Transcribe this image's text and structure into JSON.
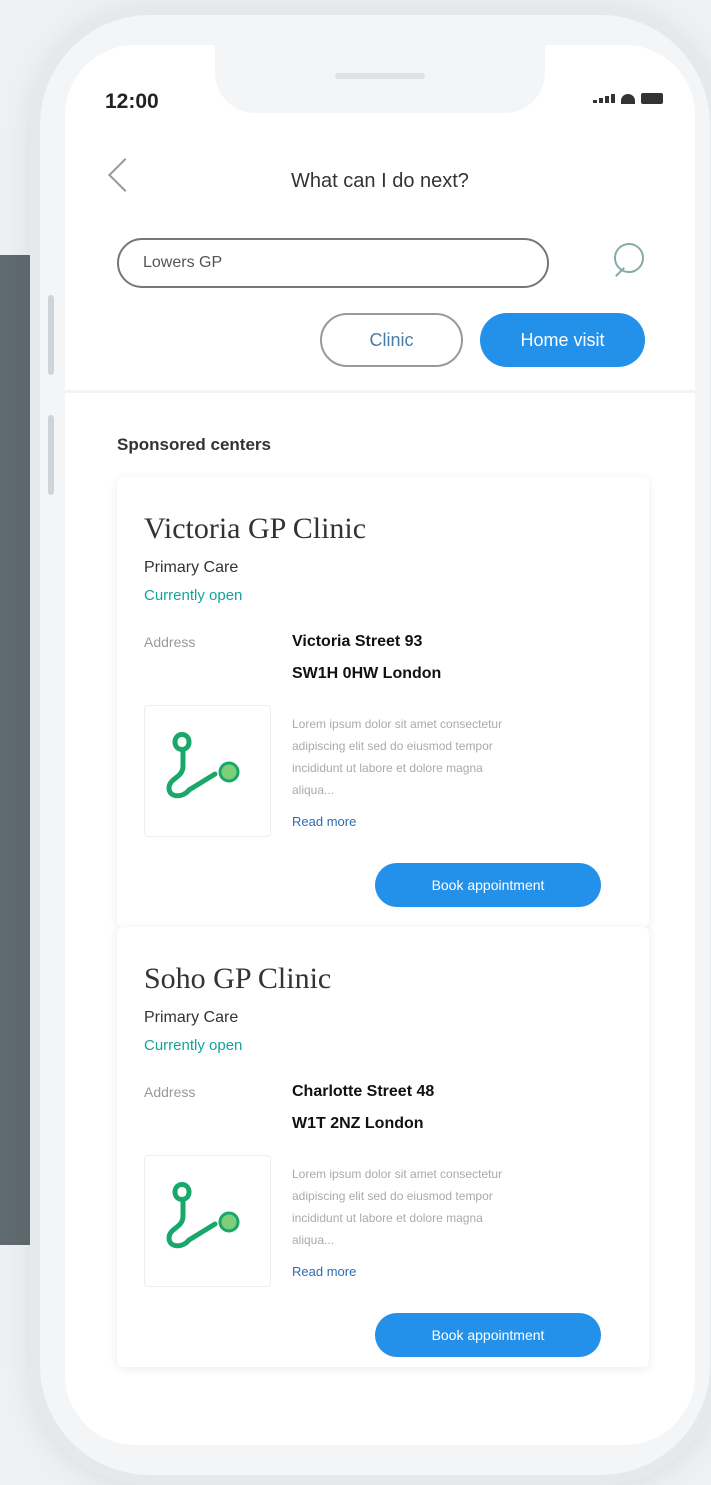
{
  "status_bar": {
    "time": "12:00"
  },
  "header": {
    "title": "What can I do next?"
  },
  "search": {
    "value": "Lowers GP"
  },
  "filters": {
    "clinic_label": "Clinic",
    "home_visit_label": "Home visit"
  },
  "section": {
    "label": "Sponsored centers"
  },
  "clinics": [
    {
      "name": "Victoria GP Clinic",
      "category": "Primary Care",
      "status": "Currently open",
      "address_label": "Address",
      "address_line1": "Victoria Street 93",
      "address_line2": "SW1H 0HW London",
      "description": "Lorem ipsum dolor sit amet consectetur adipiscing elit sed do eiusmod tempor incididunt ut labore et dolore magna aliqua...",
      "read_more": "Read more",
      "book_label": "Book appointment"
    },
    {
      "name": "Soho GP Clinic",
      "category": "Primary Care",
      "status": "Currently open",
      "address_label": "Address",
      "address_line1": "Charlotte Street 48",
      "address_line2": "W1T 2NZ London",
      "description": "Lorem ipsum dolor sit amet consectetur adipiscing elit sed do eiusmod tempor incididunt ut labore et dolore magna aliqua...",
      "read_more": "Read more",
      "book_label": "Book appointment"
    }
  ],
  "colors": {
    "accent": "#2390ea",
    "open_status": "#14a39a",
    "logo_green": "#1aa86a"
  },
  "icons": {
    "back": "chevron-left-icon",
    "search": "search-icon",
    "clinic_logo": "stethoscope-icon"
  }
}
